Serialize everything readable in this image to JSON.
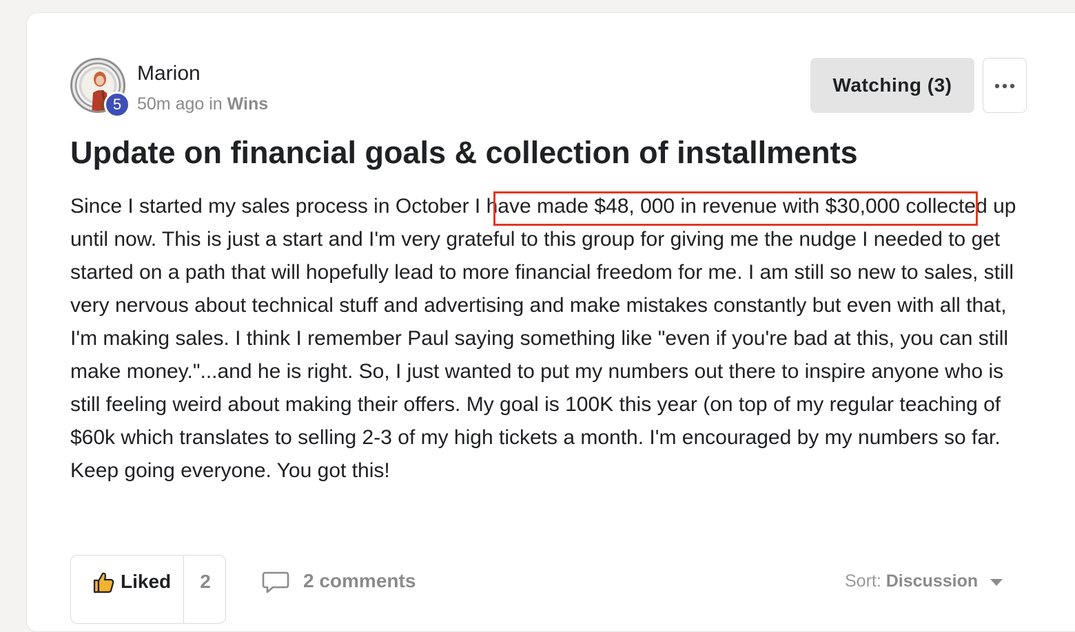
{
  "author": {
    "name": "Marion",
    "level": "5",
    "time_ago": "50m ago",
    "in_label": "in",
    "category": "Wins"
  },
  "actions": {
    "watching_label": "Watching (3)",
    "more_icon": "more-dots-icon"
  },
  "post": {
    "title": "Update on financial goals & collection of installments",
    "body_prefix": "Since I started my sales process in October ",
    "body_highlight": "I have made $48, 000 in revenue with $30,000",
    "body_rest": " collected up until now. This is just a start and I'm very grateful to this group for giving me the nudge I needed to get started on a path that will hopefully lead to more financial freedom for me. I am still so new to sales, still very nervous about technical stuff and advertising and make mistakes constantly but even with all that, I'm making sales. I think I remember Paul saying something like \"even if you're bad at this, you can still make money.\"...and he is right. So, I just wanted to put my numbers out there to inspire anyone who is still feeling weird about making their offers. My goal is 100K this year (on top of my regular teaching of $60k which translates to selling 2-3 of my high tickets a month. I'm encouraged by my numbers so far. Keep going everyone. You got this!",
    "highlight_color": "#e6371f"
  },
  "footer": {
    "liked_label": "Liked",
    "like_count": "2",
    "comments_label": "2 comments",
    "sort_label": "Sort:",
    "sort_value": "Discussion"
  },
  "colors": {
    "badge": "#3d4fb5",
    "button_bg": "#e4e4e4",
    "muted_text": "#8b8b8b"
  }
}
